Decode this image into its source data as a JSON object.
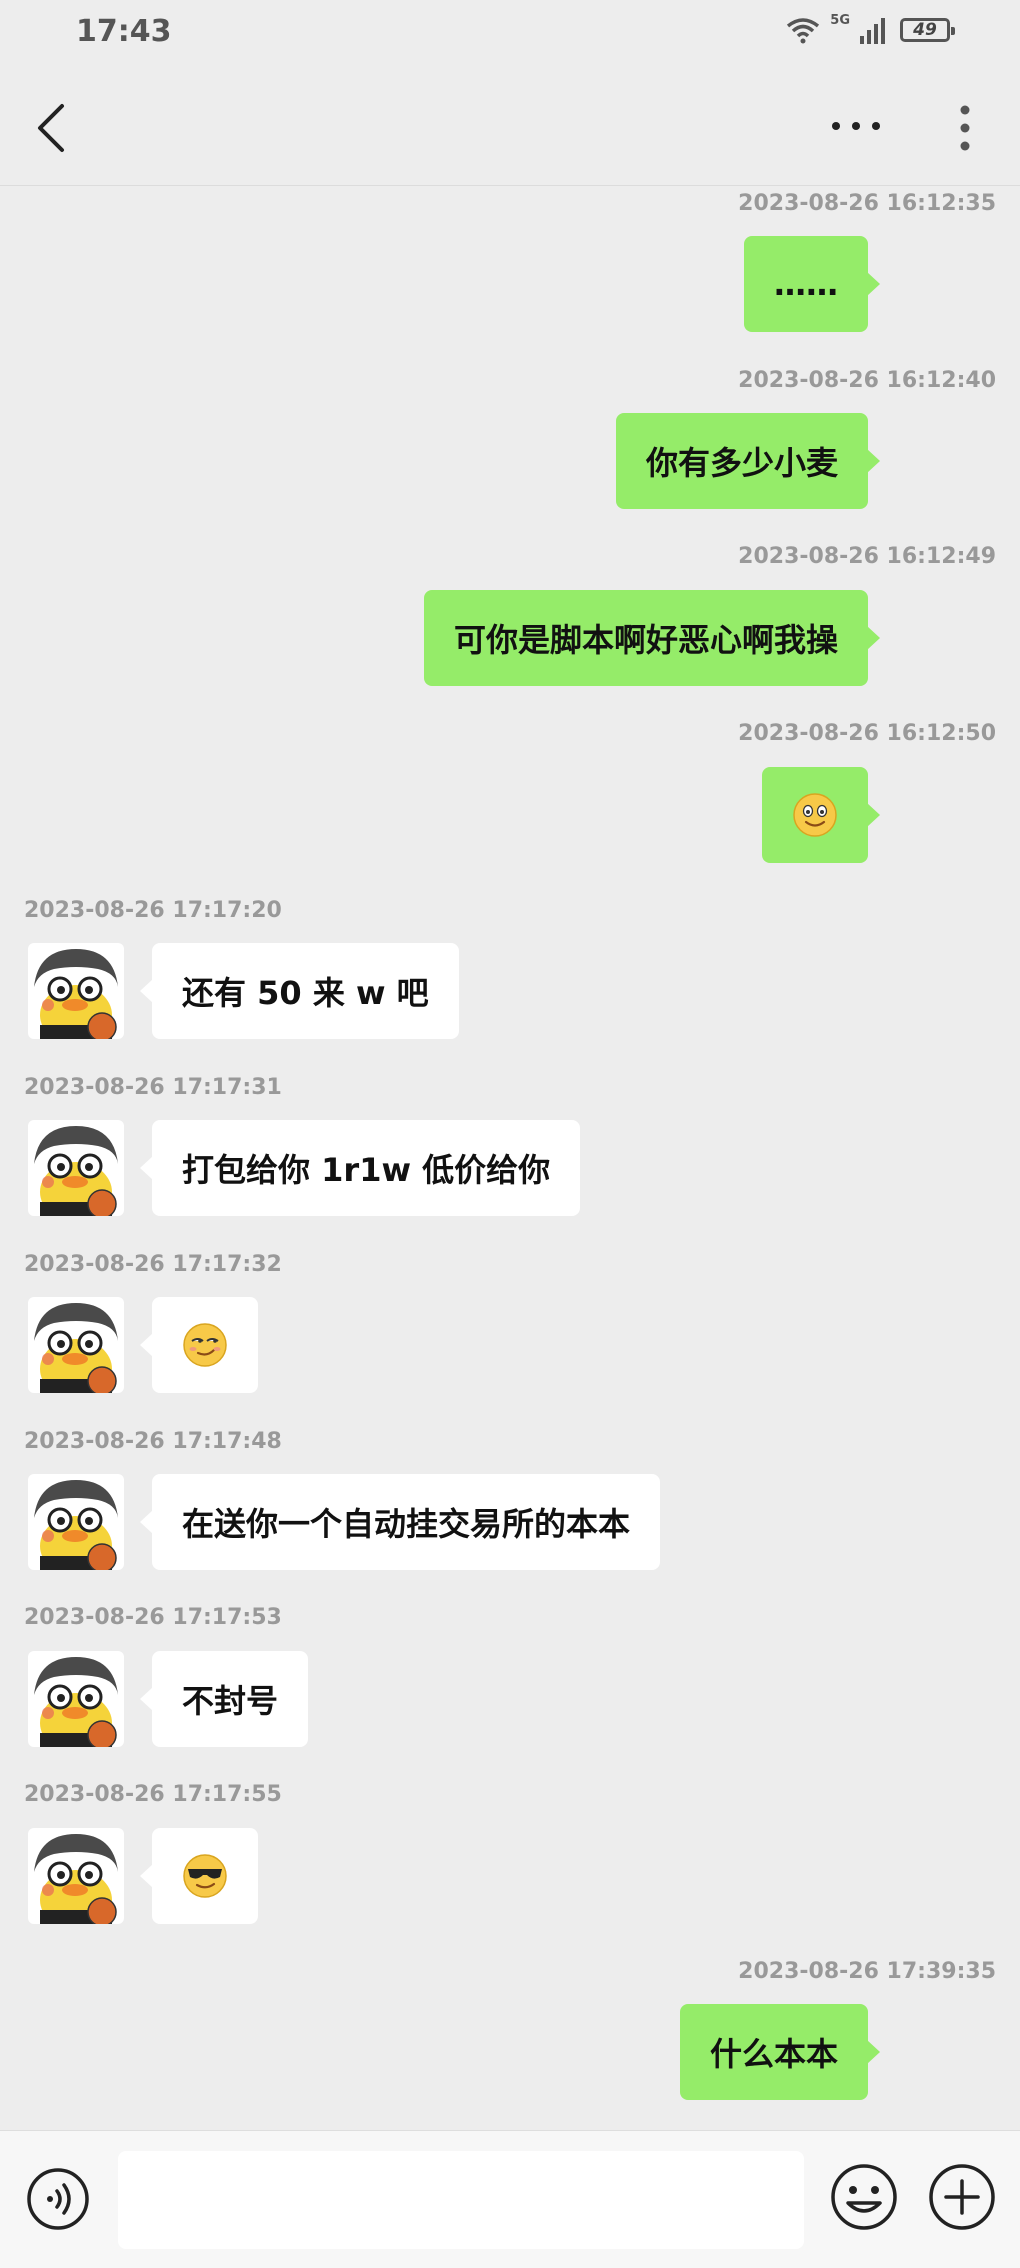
{
  "status_bar": {
    "time": "17:43",
    "network": "5G",
    "battery": "49"
  },
  "nav": {
    "back_icon": "chevron-left-icon",
    "more_icon": "ellipsis-icon",
    "menu_icon": "vertical-dots-icon"
  },
  "messages": [
    {
      "timestamp": "2023-08-26 16:12:35",
      "side": "out",
      "text": "……"
    },
    {
      "timestamp": "2023-08-26 16:12:40",
      "side": "out",
      "text": "你有多少小麦"
    },
    {
      "timestamp": "2023-08-26 16:12:49",
      "side": "out",
      "text": "可你是脚本啊好恶心啊我操"
    },
    {
      "timestamp": "2023-08-26 16:12:50",
      "side": "out",
      "emoji": "smile-emoji-icon"
    },
    {
      "timestamp": "2023-08-26 17:17:20",
      "side": "in",
      "text": "还有 50 来 w 吧"
    },
    {
      "timestamp": "2023-08-26 17:17:31",
      "side": "in",
      "text": "打包给你 1r1w 低价给你"
    },
    {
      "timestamp": "2023-08-26 17:17:32",
      "side": "in",
      "emoji": "smirk-emoji-icon"
    },
    {
      "timestamp": "2023-08-26 17:17:48",
      "side": "in",
      "text": "在送你一个自动挂交易所的本本"
    },
    {
      "timestamp": "2023-08-26 17:17:53",
      "side": "in",
      "text": "不封号"
    },
    {
      "timestamp": "2023-08-26 17:17:55",
      "side": "in",
      "emoji": "sunglasses-emoji-icon"
    },
    {
      "timestamp": "2023-08-26 17:39:35",
      "side": "out",
      "text": "什么本本"
    }
  ],
  "input_bar": {
    "placeholder": "",
    "voice_icon": "voice-icon",
    "emoji_icon": "emoji-icon",
    "plus_icon": "plus-icon"
  },
  "colors": {
    "background": "#ededed",
    "outgoing_bubble": "#95ec69",
    "incoming_bubble": "#ffffff",
    "timestamp": "#999999"
  }
}
